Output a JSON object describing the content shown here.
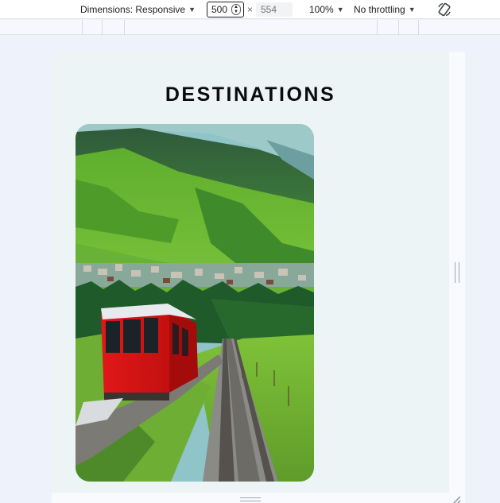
{
  "toolbar": {
    "dimensions_label": "Dimensions: Responsive",
    "width_value": "500",
    "times": "×",
    "height_placeholder": "554",
    "zoom_label": "100%",
    "throttle_label": "No throttling"
  },
  "page": {
    "heading": "DESTINATIONS",
    "image_alt": "Red funicular train descending through green Swiss valley with village and mountains"
  }
}
